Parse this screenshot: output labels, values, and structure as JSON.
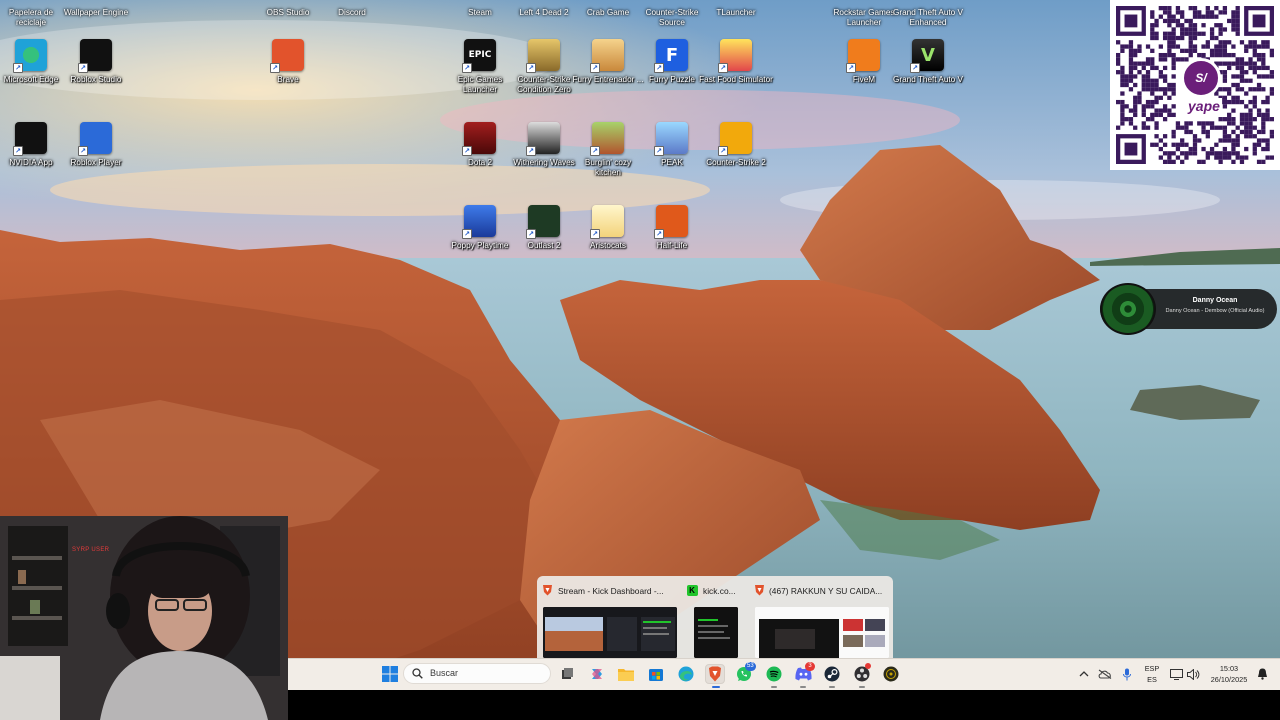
{
  "desktop": {
    "cut_row": [
      "Papelera de reciclaje",
      "Wallpaper Engine",
      "OBS Studio",
      "Discord",
      "Steam",
      "Left 4 Dead 2",
      "Crab Game",
      "Counter-Strike Source",
      "TLauncher",
      "Rockstar Games Launcher",
      "Grand Theft Auto V Enhanced"
    ],
    "icons": [
      {
        "label": "Microsoft Edge",
        "icon": "edge-icon"
      },
      {
        "label": "Roblox Studio",
        "icon": "roblox-studio-icon"
      },
      {
        "label": "Brave",
        "icon": "brave-icon"
      },
      {
        "label": "Epic Games Launcher",
        "icon": "epic-games-icon",
        "glyph": "EPIC"
      },
      {
        "label": "Counter-Strike Condition Zero",
        "icon": "cs-condition-zero-icon"
      },
      {
        "label": "Furry Entrenador ...",
        "icon": "furry-trainer-icon"
      },
      {
        "label": "Furry Puzzle",
        "icon": "furry-puzzle-icon",
        "glyph": "F"
      },
      {
        "label": "Fast Food Simulator",
        "icon": "fast-food-icon"
      },
      {
        "label": "FiveM",
        "icon": "fivem-icon"
      },
      {
        "label": "Grand Theft Auto V",
        "icon": "gta-v-icon",
        "glyph": "V"
      },
      {
        "label": "NVIDIA App",
        "icon": "nvidia-icon"
      },
      {
        "label": "Roblox Player",
        "icon": "roblox-player-icon"
      },
      {
        "label": "Dota 2",
        "icon": "dota-2-icon"
      },
      {
        "label": "Withering Waves",
        "icon": "withering-waves-icon"
      },
      {
        "label": "Burglin' cozy kitchen",
        "icon": "cozy-kitchen-icon"
      },
      {
        "label": "PEAK",
        "icon": "peak-icon"
      },
      {
        "label": "Counter-Strike 2",
        "icon": "cs2-icon"
      },
      {
        "label": "Poppy Playtime",
        "icon": "poppy-playtime-icon"
      },
      {
        "label": "Outlast 2",
        "icon": "outlast-2-icon"
      },
      {
        "label": "Aristocats",
        "icon": "aristocats-icon"
      },
      {
        "label": "Half-Life",
        "icon": "half-life-icon"
      }
    ]
  },
  "qr": {
    "brand": "yape",
    "badge": "S/"
  },
  "now_playing": {
    "artist": "Danny Ocean",
    "track": "Danny Ocean - Dembow (Official Audio)"
  },
  "webcam": {
    "label": "SYRP USER"
  },
  "taskbar": {
    "search_placeholder": "Buscar",
    "badges": {
      "whatsapp": "53",
      "discord": "3"
    },
    "language": "ESP",
    "region": "ES",
    "time": "15:03",
    "date": "26/10/2025"
  },
  "preview": {
    "windows": [
      {
        "title": "Stream - Kick Dashboard -..."
      },
      {
        "title": "kick.co..."
      },
      {
        "title": "(467) RAKKUN Y SU CAIDA..."
      }
    ]
  },
  "colors": {
    "taskbar_bg": "#f2ede7",
    "accent": "#2b6ad8",
    "win_blue": "#1f7fe0"
  }
}
